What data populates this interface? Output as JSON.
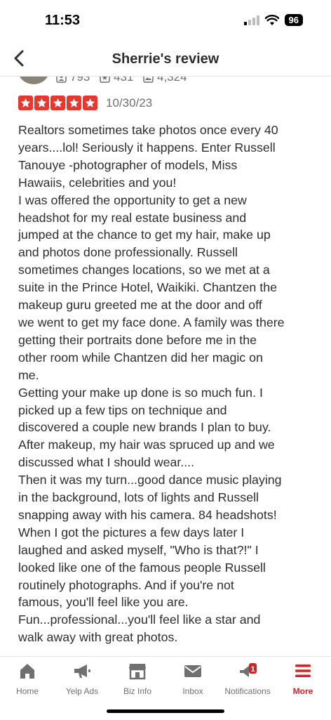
{
  "status": {
    "time": "11:53",
    "battery": "96"
  },
  "nav": {
    "title": "Sherrie's review"
  },
  "user": {
    "stats": [
      {
        "icon": "friends-icon",
        "value": "793"
      },
      {
        "icon": "reviews-icon",
        "value": "431"
      },
      {
        "icon": "photos-icon",
        "value": "4,324"
      }
    ]
  },
  "review": {
    "rating": 5,
    "date": "10/30/23",
    "lines": [
      "Realtors sometimes take photos once every 40",
      "years....lol! Seriously it happens. Enter Russell",
      "Tanouye -photographer of models, Miss",
      "Hawaiis, celebrities and you!",
      "I was offered the opportunity to get a new",
      "headshot for my real estate business and",
      "jumped at the chance to get my hair, make up",
      "and photos done professionally.  Russell",
      "sometimes changes locations, so we met at a",
      "suite in the Prince Hotel, Waikiki. Chantzen the",
      "makeup guru greeted me at the door and off",
      "we went to get my face done. A family was there",
      "getting their portraits done before me in the",
      "other room while Chantzen did her magic on",
      "me.",
      "Getting your make up done is so much fun. I",
      "picked up a few tips on technique and",
      "discovered a couple new brands I plan to buy.",
      "After makeup, my hair was spruced up and we",
      "discussed what I should wear....",
      "Then it was my turn...good dance music playing",
      "in the background, lots of lights and Russell",
      "snapping away with his camera. 84 headshots!",
      "When I got the pictures a few days later I",
      "laughed and asked myself, \"Who is that?!\" I",
      "looked like one of the famous people Russell",
      "routinely photographs. And if you're not",
      "famous, you'll feel like you are.",
      "Fun...professional...you'll feel like a star and",
      "walk away with great photos."
    ]
  },
  "tabs": [
    {
      "label": "Home",
      "icon": "home-icon"
    },
    {
      "label": "Yelp Ads",
      "icon": "megaphone-icon"
    },
    {
      "label": "Biz Info",
      "icon": "storefront-icon"
    },
    {
      "label": "Inbox",
      "icon": "mail-icon"
    },
    {
      "label": "Notifications",
      "icon": "notifications-icon",
      "badge": "1"
    },
    {
      "label": "More",
      "icon": "menu-icon"
    }
  ],
  "colors": {
    "accent": "#d32323",
    "star": "#e7382f",
    "text": "#2d2e2f",
    "muted": "#6e7072"
  }
}
